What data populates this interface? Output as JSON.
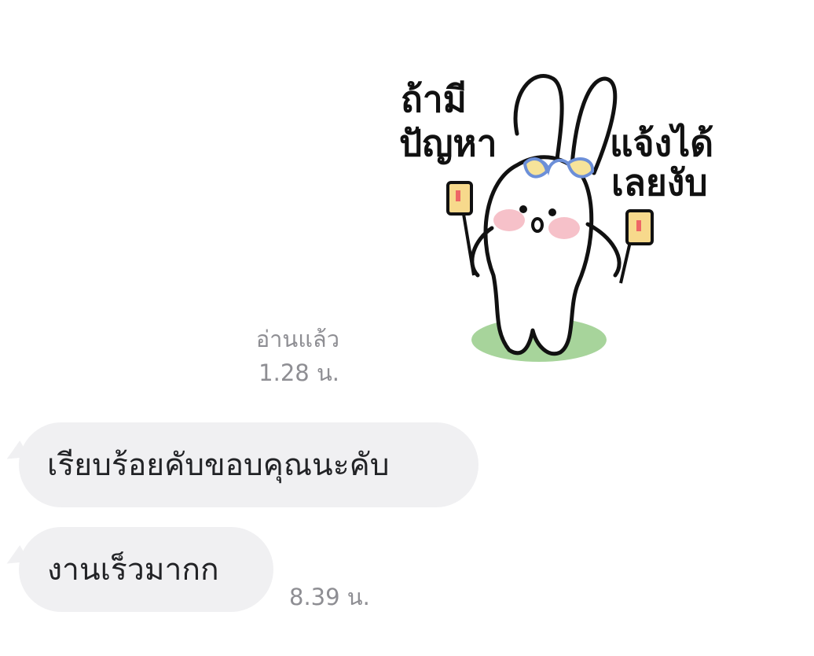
{
  "sticker": {
    "text_left_1": "ถ้ามี",
    "text_left_2": "ปัญหา",
    "text_right_1": "แจ้งได้",
    "text_right_2": "เลยงับ"
  },
  "outgoing": {
    "read_label": "อ่านแล้ว",
    "time": "1.28 น."
  },
  "incoming": {
    "messages": [
      {
        "text": "เรียบร้อยคับขอบคุณนะคับ"
      },
      {
        "text": "งานเร็วมากก"
      }
    ],
    "time": "8.39 น."
  }
}
